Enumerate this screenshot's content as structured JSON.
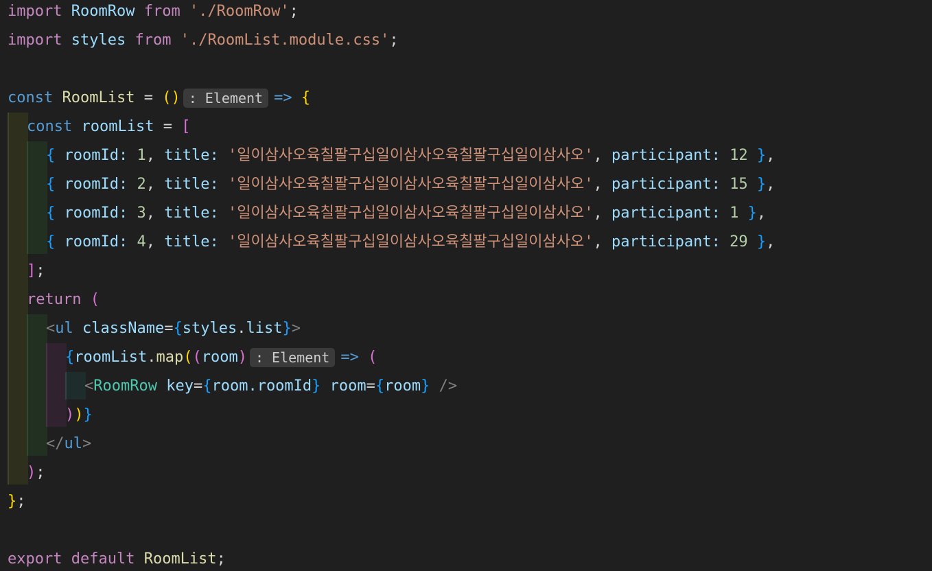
{
  "code": {
    "l1": {
      "import": "import",
      "name": "RoomRow",
      "from": "from",
      "path": "'./RoomRow'",
      "semi": ";"
    },
    "l2": {
      "import": "import",
      "name": "styles",
      "from": "from",
      "path": "'./RoomList.module.css'",
      "semi": ";"
    },
    "l4": {
      "const": "const",
      "name": "RoomList",
      "eq": " = ",
      "parens": "()",
      "hint": ": Element",
      "arrow": "=>",
      "brace": "{"
    },
    "l5": {
      "const": "const",
      "name": "roomList",
      "eq": " = ",
      "bracket": "["
    },
    "rows": [
      {
        "room_id": "1",
        "title": "'일이삼사오육칠팔구십일이삼사오육칠팔구십일이삼사오'",
        "participant": "12"
      },
      {
        "room_id": "2",
        "title": "'일이삼사오육칠팔구십일이삼사오육칠팔구십일이삼사오'",
        "participant": "15"
      },
      {
        "room_id": "3",
        "title": "'일이삼사오육칠팔구십일이삼사오육칠팔구십일이삼사오'",
        "participant": "1"
      },
      {
        "room_id": "4",
        "title": "'일이삼사오육칠팔구십일이삼사오육칠팔구십일이삼사오'",
        "participant": "29"
      }
    ],
    "row_keys": {
      "room_id": "roomId",
      "title": "title",
      "participant": "participant"
    },
    "l10": {
      "bracket": "]",
      "semi": ";"
    },
    "l11": {
      "return": "return",
      "paren": "("
    },
    "l12": {
      "open": "<",
      "tag": "ul",
      "attr": "className",
      "eq": "=",
      "lb": "{",
      "obj": "styles",
      "dot": ".",
      "prop": "list",
      "rb": "}",
      "close": ">"
    },
    "l13": {
      "lb": "{",
      "obj": "roomList",
      "dot": ".",
      "fn": "map",
      "p1": "(",
      "p2": "(",
      "param": "room",
      "p3": ")",
      "hint": ": Element",
      "arrow": "=>",
      "p4": "("
    },
    "l14": {
      "open": "<",
      "comp": "RoomRow",
      "attr1": "key",
      "eq1": "=",
      "lb1": "{",
      "val1": "room.roomId",
      "rb1": "}",
      "attr2": "room",
      "eq2": "=",
      "lb2": "{",
      "val2": "room",
      "rb2": "}",
      "close": "/>"
    },
    "l15": {
      "p1": ")",
      "p2": ")",
      "rb": "}"
    },
    "l16": {
      "open": "</",
      "tag": "ul",
      "close": ">"
    },
    "l17": {
      "paren": ")",
      "semi": ";"
    },
    "l18": {
      "brace": "}",
      "semi": ";"
    },
    "l20": {
      "export": "export",
      "default": "default",
      "name": "RoomList",
      "semi": ";"
    }
  }
}
